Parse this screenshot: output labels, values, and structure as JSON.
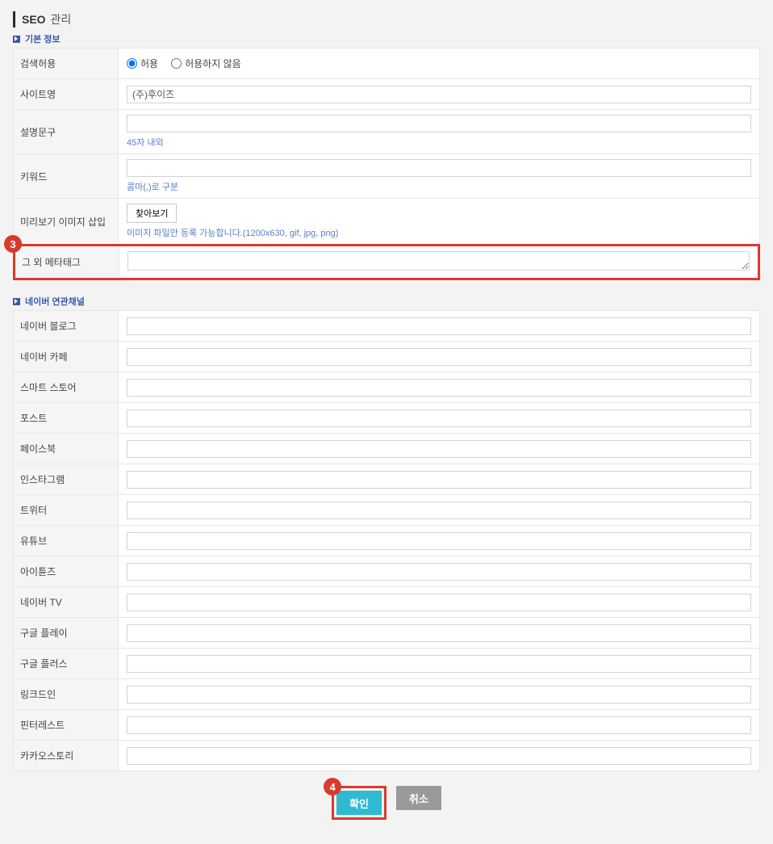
{
  "page": {
    "title_strong": "SEO",
    "title_suffix": "관리"
  },
  "sections": {
    "basic": "기본 정보",
    "channels": "네이버 연관채널"
  },
  "basic": {
    "rows": {
      "search_allow": {
        "label": "검색허용",
        "options": {
          "allow": "허용",
          "deny": "허용하지 않음"
        }
      },
      "site_name": {
        "label": "사이트명",
        "value": "(주)후이즈"
      },
      "description": {
        "label": "설명문구",
        "hint": "45자 내외"
      },
      "keywords": {
        "label": "키워드",
        "hint": "콤마(,)로 구분"
      },
      "preview_image": {
        "label": "미리보기 이미지 삽입",
        "button": "찾아보기",
        "hint": "이미지 파일만 등록 가능합니다.(1200x630, gif, jpg, png)"
      },
      "meta_tag": {
        "label": "그 외 메타태그"
      }
    }
  },
  "channels": {
    "items": [
      {
        "key": "naver_blog",
        "label": "네이버 블로그"
      },
      {
        "key": "naver_cafe",
        "label": "네이버 카페"
      },
      {
        "key": "smart_store",
        "label": "스마트 스토어"
      },
      {
        "key": "post",
        "label": "포스트"
      },
      {
        "key": "facebook",
        "label": "페이스북"
      },
      {
        "key": "instagram",
        "label": "인스타그램"
      },
      {
        "key": "twitter",
        "label": "트위터"
      },
      {
        "key": "youtube",
        "label": "유튜브"
      },
      {
        "key": "itunes",
        "label": "아이튠즈"
      },
      {
        "key": "naver_tv",
        "label": "네이버 TV"
      },
      {
        "key": "google_play",
        "label": "구글 플레이"
      },
      {
        "key": "google_plus",
        "label": "구글 플러스"
      },
      {
        "key": "linkedin",
        "label": "링크드인"
      },
      {
        "key": "pinterest",
        "label": "핀터레스트"
      },
      {
        "key": "kakaostory",
        "label": "카카오스토리"
      }
    ]
  },
  "buttons": {
    "confirm": "확인",
    "cancel": "취소"
  },
  "annotations": {
    "badge3": "3",
    "badge4": "4"
  }
}
